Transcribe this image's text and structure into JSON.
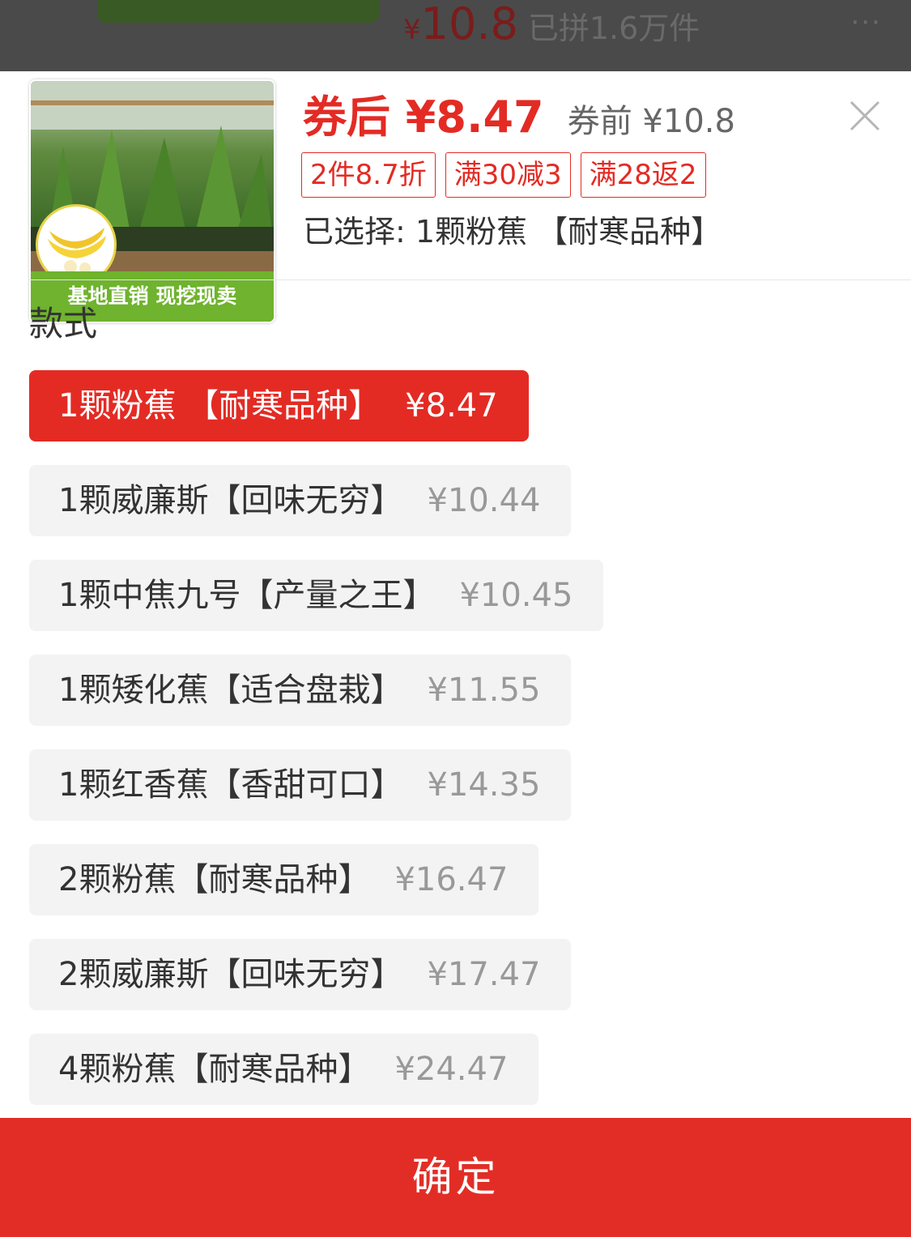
{
  "background_page": {
    "price_symbol": "¥",
    "price_value": "10.8",
    "sold_text": "已拼1.6万件",
    "more_label": "···"
  },
  "product": {
    "thumb_banner": "基地直销 现挖现卖",
    "price_after": "券后 ¥8.47",
    "price_before": "券前 ¥10.8",
    "promos": [
      "2件8.7折",
      "满30减3",
      "满28返2"
    ],
    "selected_text": "已选择: 1颗粉蕉 【耐寒品种】"
  },
  "sku": {
    "section_title": "款式",
    "options": [
      {
        "label": "1颗粉蕉 【耐寒品种】",
        "price": "¥8.47",
        "selected": true
      },
      {
        "label": "1颗威廉斯【回味无穷】",
        "price": "¥10.44",
        "selected": false
      },
      {
        "label": "1颗中焦九号【产量之王】",
        "price": "¥10.45",
        "selected": false
      },
      {
        "label": "1颗矮化蕉【适合盘栽】",
        "price": "¥11.55",
        "selected": false
      },
      {
        "label": "1颗红香蕉【香甜可口】",
        "price": "¥14.35",
        "selected": false
      },
      {
        "label": "2颗粉蕉【耐寒品种】",
        "price": "¥16.47",
        "selected": false
      },
      {
        "label": "2颗威廉斯【回味无穷】",
        "price": "¥17.47",
        "selected": false
      },
      {
        "label": "4颗粉蕉【耐寒品种】",
        "price": "¥24.47",
        "selected": false
      }
    ]
  },
  "confirm_label": "确定",
  "colors": {
    "accent": "#e32b24",
    "option_bg": "#f3f3f3",
    "muted_price": "#999999"
  },
  "icons": {
    "close": "close-icon"
  }
}
